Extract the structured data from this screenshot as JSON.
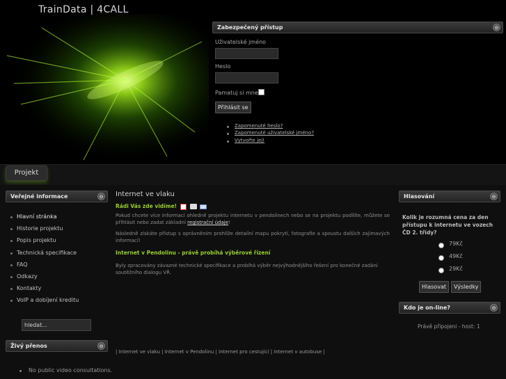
{
  "header": {
    "site_title": "TrainData | 4CALL"
  },
  "login": {
    "title": "Zabezpečený přístup",
    "collapse_icon": "⊖",
    "username_label": "Uživatelské jméno",
    "password_label": "Heslo",
    "remember_label": "Pamatuj si mne",
    "submit_label": "Přihlásit se",
    "links": [
      "Zapomenuté heslo?",
      "Zapomenuté uživatelské jméno?",
      "Vytvořte jej!"
    ]
  },
  "nav": {
    "tab": "Projekt"
  },
  "sidebar": {
    "public_title": "Veřejné informace",
    "items": [
      "Hlavní stránka",
      "Historie projektu",
      "Popis projektu",
      "Technická specifikace",
      "FAQ",
      "Odkazy",
      "Kontakty",
      "VoIP a dobíjení kreditu"
    ],
    "search_placeholder": "hledat...",
    "live_title": "Živý přenos",
    "live_note": "No public video consultations."
  },
  "main": {
    "title": "Internet ve vlaku",
    "welcome": "Rádi Vás zde vidíme!",
    "intro_1": "Pokud chcete více informací ohledně projektu internetu v pendolinech nebo se na projektu podílíte, můžete se přihlásit nebo zadat základní",
    "intro_link": "registrační údaje",
    "intro_1_end": "!",
    "intro_2": "Následně získáte přístup s oprávněním prohlíže detailní mapu pokrytí, fotografie a spoustu dalších zajímavých informací!",
    "headline": "Internet v Pendolinu - právě probíhá výběrové řízení",
    "body": "Byly zpracovány závazné technické specifikace a probíhá výběr nejvýhodnějšího řešení pro konečné zadání soutěžního dialogu VŘ.",
    "footer_links": "| Internet ve vlaku | Internet v Pendolinu | Internet pro cestující | Internet v autobuse |"
  },
  "poll": {
    "title": "Hlasování",
    "question": "Kolik je rozumná cena za den přístupu k internetu ve vozech ČD 2. třídy?",
    "options": [
      "79Kč",
      "49Kč",
      "29Kč"
    ],
    "vote_label": "Hlasovat",
    "results_label": "Výsledky"
  },
  "online": {
    "title": "Kdo je on-line?",
    "status": "Právě připojeni - host: 1"
  },
  "colors": {
    "accent_green": "#9acd32",
    "background": "#000000"
  }
}
